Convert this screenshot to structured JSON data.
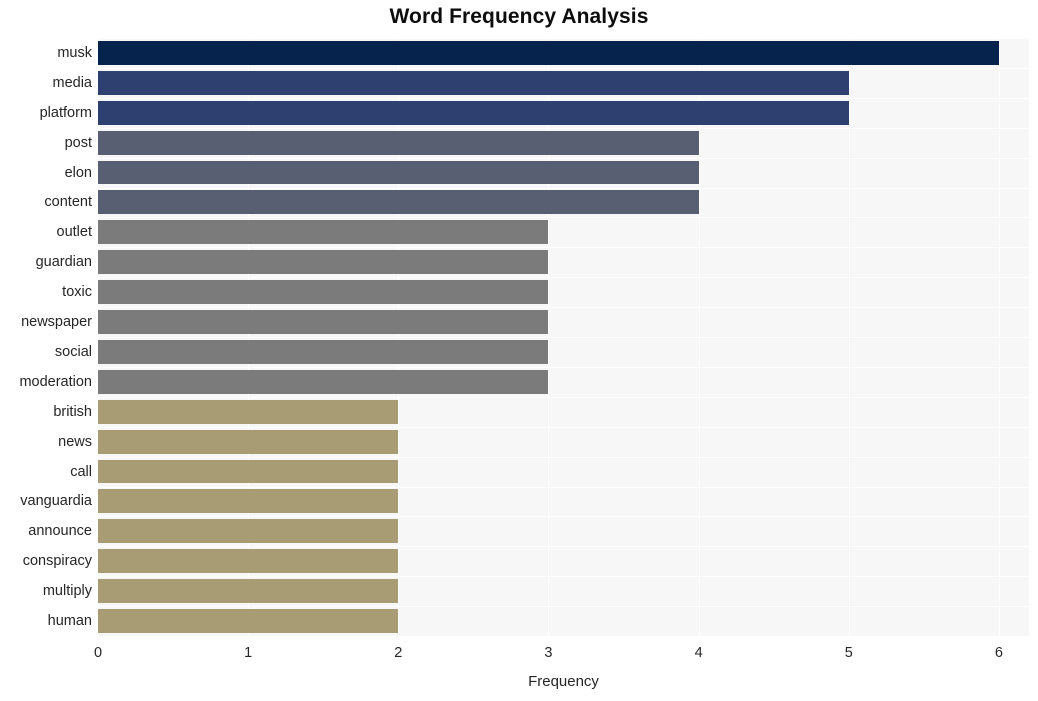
{
  "chart_data": {
    "type": "bar",
    "orientation": "horizontal",
    "title": "Word Frequency Analysis",
    "xlabel": "Frequency",
    "ylabel": "",
    "xlim": [
      0,
      6.2
    ],
    "xticks": [
      "0",
      "1",
      "2",
      "3",
      "4",
      "5",
      "6"
    ],
    "xtick_values": [
      0,
      1,
      2,
      3,
      4,
      5,
      6
    ],
    "grid": true,
    "legend": "none",
    "categories": [
      "musk",
      "media",
      "platform",
      "post",
      "elon",
      "content",
      "outlet",
      "guardian",
      "toxic",
      "newspaper",
      "social",
      "moderation",
      "british",
      "news",
      "call",
      "vanguardia",
      "announce",
      "conspiracy",
      "multiply",
      "human"
    ],
    "values": [
      6,
      5,
      5,
      4,
      4,
      4,
      3,
      3,
      3,
      3,
      3,
      3,
      2,
      2,
      2,
      2,
      2,
      2,
      2,
      2
    ],
    "bar_colors": [
      "#05234c",
      "#2e4070",
      "#2e4070",
      "#595f73",
      "#595f73",
      "#595f73",
      "#7b7b7b",
      "#7b7b7b",
      "#7b7b7b",
      "#7b7b7b",
      "#7b7b7b",
      "#7b7b7b",
      "#a79c73",
      "#a79c73",
      "#a79c73",
      "#a79c73",
      "#a79c73",
      "#a79c73",
      "#a79c73",
      "#a79c73"
    ],
    "plot_background": "#f7f7f7",
    "grid_color": "#ffffff",
    "figure_background": "#ffffff",
    "text_color": "#262626"
  }
}
